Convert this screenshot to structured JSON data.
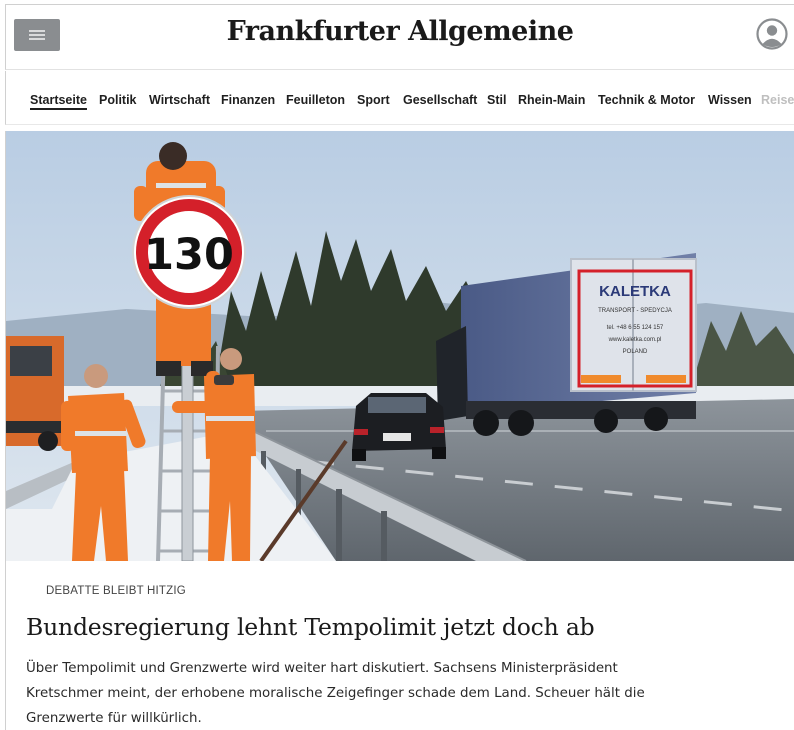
{
  "header": {
    "brand": "Frankfurter Allgemeine",
    "menu_icon": "hamburger-menu-icon",
    "profile_icon": "user-profile-icon"
  },
  "nav": {
    "items": [
      {
        "label": "Startseite",
        "active": true
      },
      {
        "label": "Politik"
      },
      {
        "label": "Wirtschaft"
      },
      {
        "label": "Finanzen"
      },
      {
        "label": "Feuilleton"
      },
      {
        "label": "Sport"
      },
      {
        "label": "Gesellschaft"
      },
      {
        "label": "Stil"
      },
      {
        "label": "Rhein-Main"
      },
      {
        "label": "Technik & Motor"
      },
      {
        "label": "Wissen"
      },
      {
        "label": "Reise",
        "faded": true
      }
    ]
  },
  "hero": {
    "sign_text": "130",
    "truck_brand": "KALETKA",
    "truck_sub": "TRANSPORT - SPEDYCJA",
    "truck_tel": "tel. +48 6 55 124 157",
    "truck_web": "www.kaletka.com.pl",
    "truck_country": "POLAND"
  },
  "article": {
    "kicker": "DEBATTE BLEIBT HITZIG",
    "headline": "Bundesregierung lehnt Tempolimit jetzt doch ab",
    "summary_line1": "Über Tempolimit und Grenzwerte wird weiter hart diskutiert. Sachsens Ministerpräsident",
    "summary_line2": "Kretschmer meint, der erhobene moralische Zeigefinger schade dem Land. Scheuer hält die",
    "summary_line3": "Grenzwerte für willkürlich."
  },
  "colors": {
    "menu_button": "#8a8d90",
    "sky": "#c9d7e6",
    "safety_orange": "#f07a2a",
    "sign_red": "#d4202a"
  }
}
